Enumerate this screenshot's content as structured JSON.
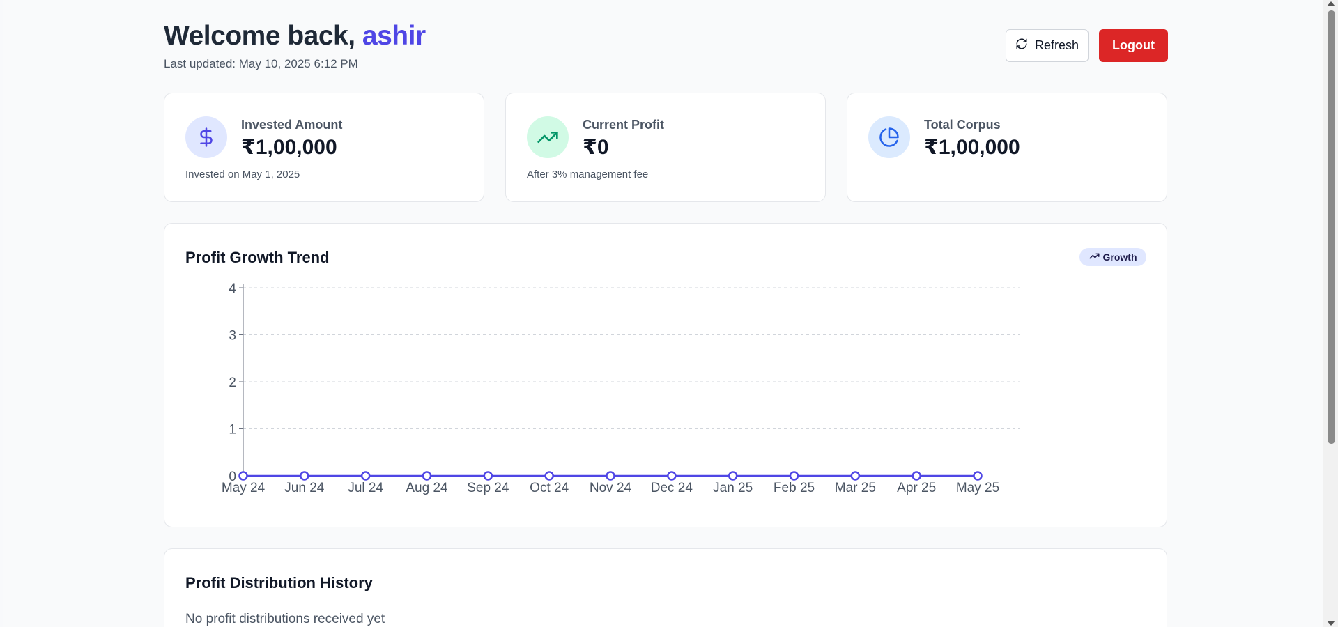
{
  "header": {
    "welcome": "Welcome back, ",
    "username": "ashir",
    "last_updated": "Last updated: May 10, 2025 6:12 PM",
    "refresh_label": "Refresh",
    "logout_label": "Logout"
  },
  "stats": [
    {
      "label": "Invested Amount",
      "value": "₹1,00,000",
      "note": "Invested on May 1, 2025",
      "icon": "dollar-icon",
      "icon_bg": "#e0e7ff",
      "icon_color": "#4f46e5"
    },
    {
      "label": "Current Profit",
      "value": "₹0",
      "note": "After 3% management fee",
      "icon": "trending-up-icon",
      "icon_bg": "#d1fae5",
      "icon_color": "#059669"
    },
    {
      "label": "Total Corpus",
      "value": "₹1,00,000",
      "note": "",
      "icon": "pie-chart-icon",
      "icon_bg": "#dbeafe",
      "icon_color": "#2563eb"
    }
  ],
  "chart_section": {
    "title": "Profit Growth Trend",
    "badge": "Growth"
  },
  "chart_data": {
    "type": "line",
    "categories": [
      "May 24",
      "Jun 24",
      "Jul 24",
      "Aug 24",
      "Sep 24",
      "Oct 24",
      "Nov 24",
      "Dec 24",
      "Jan 25",
      "Feb 25",
      "Mar 25",
      "Apr 25",
      "May 25"
    ],
    "series": [
      {
        "values": [
          0,
          0,
          0,
          0,
          0,
          0,
          0,
          0,
          0,
          0,
          0,
          0,
          0
        ],
        "color": "#4f46e5"
      }
    ],
    "ylim": [
      0,
      4
    ],
    "yticks": [
      0,
      1,
      2,
      3,
      4
    ],
    "grid": true,
    "xlabel": "",
    "ylabel": ""
  },
  "history": {
    "title": "Profit Distribution History",
    "empty": "No profit distributions received yet"
  },
  "colors": {
    "accent": "#4f46e5",
    "danger": "#dc2626"
  }
}
